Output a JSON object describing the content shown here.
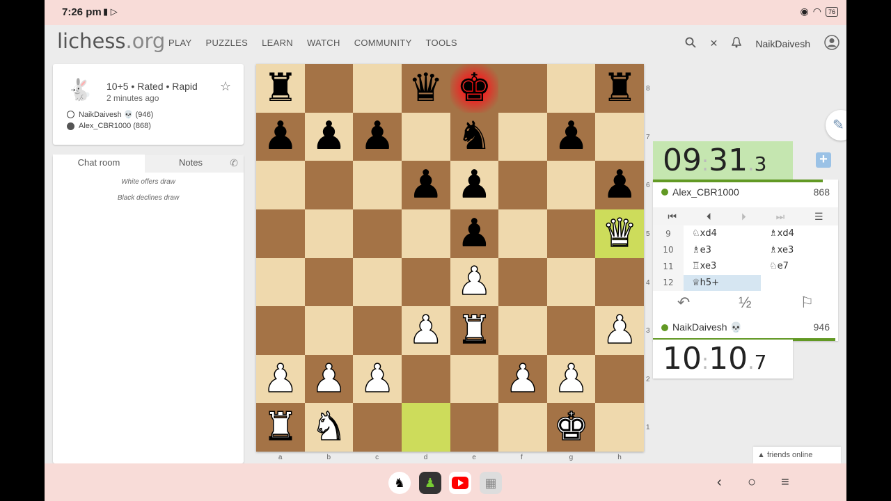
{
  "status": {
    "time": "7:26 pm",
    "battery": "76"
  },
  "nav": {
    "logo_main": "lichess",
    "logo_tld": ".org",
    "items": [
      "PLAY",
      "PUZZLES",
      "LEARN",
      "WATCH",
      "COMMUNITY",
      "TOOLS"
    ],
    "username": "NaikDaivesh"
  },
  "game": {
    "mode": "10+5 • Rated • Rapid",
    "ago": "2 minutes ago",
    "white": "NaikDaivesh 💀 (946)",
    "black": "Alex_CBR1000 (868)"
  },
  "chat": {
    "tab_chat": "Chat room",
    "tab_notes": "Notes",
    "messages": [
      "White offers draw",
      "Black declines draw"
    ]
  },
  "board": {
    "ranks": [
      "8",
      "7",
      "6",
      "5",
      "4",
      "3",
      "2",
      "1"
    ],
    "files": [
      "a",
      "b",
      "c",
      "d",
      "e",
      "f",
      "g",
      "h"
    ],
    "position": [
      [
        "br",
        "",
        "",
        "bq",
        "bk",
        "",
        "",
        "br"
      ],
      [
        "bp",
        "bp",
        "bp",
        "",
        "bn",
        "",
        "bp",
        ""
      ],
      [
        "",
        "",
        "",
        "bp",
        "bp",
        "",
        "",
        "bp"
      ],
      [
        "",
        "",
        "",
        "",
        "bp",
        "",
        "",
        "wq"
      ],
      [
        "",
        "",
        "",
        "",
        "wp",
        "",
        "",
        ""
      ],
      [
        "",
        "",
        "",
        "wp",
        "wr",
        "",
        "",
        "wp"
      ],
      [
        "wp",
        "wp",
        "wp",
        "",
        "",
        "wp",
        "wp",
        ""
      ],
      [
        "wr",
        "wn",
        "",
        "",
        "",
        "",
        "wk",
        ""
      ]
    ],
    "last_move": [
      "d1",
      "h5"
    ],
    "check": "e8"
  },
  "clocks": {
    "top": {
      "main": "09",
      "sec": "31",
      "tenth": "3"
    },
    "bottom": {
      "main": "10",
      "sec": "10",
      "tenth": "7"
    }
  },
  "players": {
    "top": {
      "name": "Alex_CBR1000",
      "rating": "868"
    },
    "bottom": {
      "name": "NaikDaivesh 💀",
      "rating": "946"
    }
  },
  "moves": [
    {
      "n": "9",
      "w": "♘xd4",
      "b": "♗xd4"
    },
    {
      "n": "10",
      "w": "♗e3",
      "b": "♗xe3"
    },
    {
      "n": "11",
      "w": "♖xe3",
      "b": "♘e7"
    },
    {
      "n": "12",
      "w": "♕h5+",
      "b": ""
    }
  ],
  "actions": {
    "takeback": "↶",
    "draw": "½",
    "resign": "⚐"
  },
  "friends": "friends online",
  "colors": {
    "accent_green": "#629924",
    "board_light": "#efd9ad",
    "board_dark": "#a47346"
  }
}
